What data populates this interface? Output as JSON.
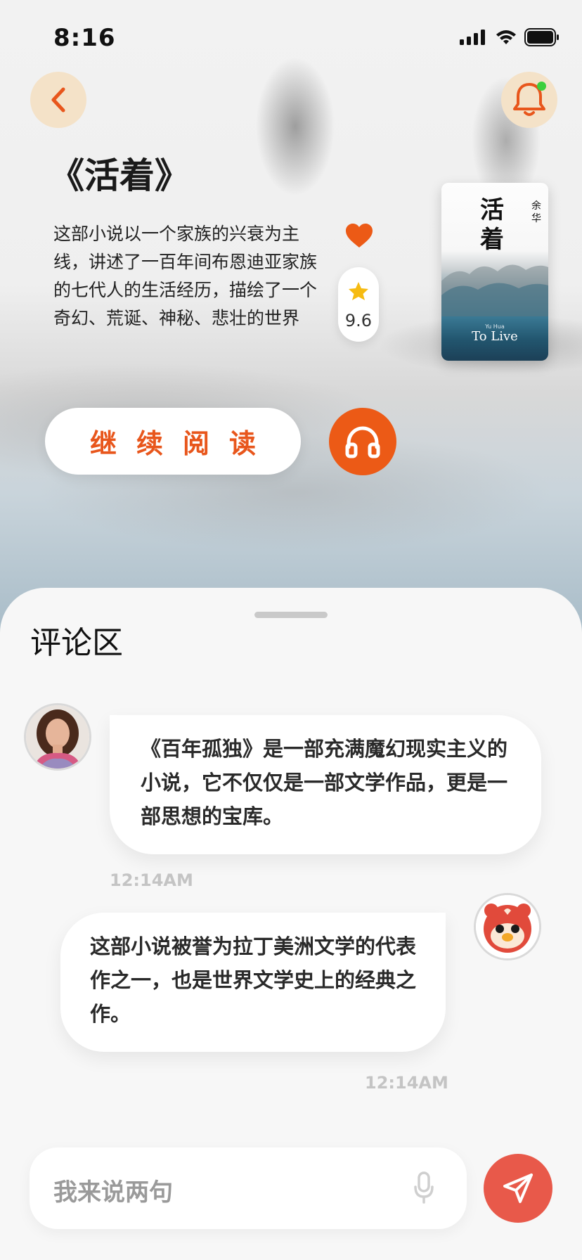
{
  "status_bar": {
    "time": "8:16"
  },
  "book": {
    "title": "《活着》",
    "description": "这部小说以一个家族的兴衰为主线，讲述了一百年间布恩迪亚家族的七代人的生活经历，描绘了一个奇幻、荒诞、神秘、悲壮的世界",
    "rating": "9.6",
    "cover": {
      "title": "活着",
      "author": "余华",
      "pinyin": "Yu Hua",
      "english_title": "To Live"
    }
  },
  "actions": {
    "read_label": "继续阅读"
  },
  "comments": {
    "title": "评论区",
    "items": [
      {
        "text": "《百年孤独》是一部充满魔幻现实主义的小说，它不仅仅是一部文学作品，更是一部思想的宝库。",
        "time": "12:14AM"
      },
      {
        "text": "这部小说被誉为拉丁美洲文学的代表作之一，也是世界文学史上的经典之作。",
        "time": "12:14AM"
      }
    ]
  },
  "composer": {
    "placeholder": "我来说两句"
  },
  "colors": {
    "accent": "#ec5a16",
    "send": "#e8594a",
    "icon_bg": "#f4e2c8"
  }
}
